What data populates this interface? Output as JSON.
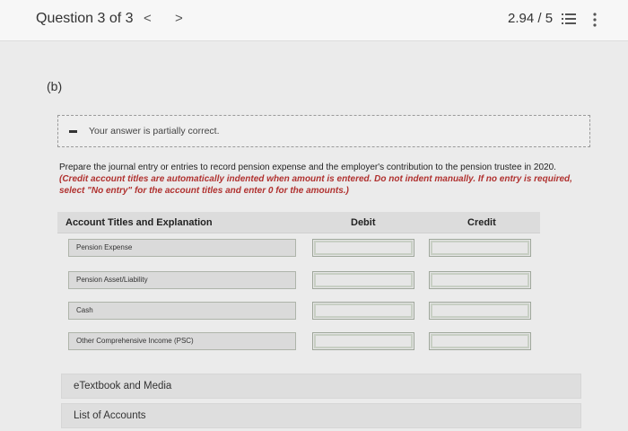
{
  "header": {
    "question": "Question 3 of 3",
    "prev_glyph": "<",
    "next_glyph": ">",
    "score": "2.94 / 5",
    "icons": [
      "list-icon",
      "more-vertical-icon"
    ]
  },
  "part": "(b)",
  "feedback": {
    "icon": "dash-icon",
    "text": "Your answer is partially correct."
  },
  "instructions": {
    "prompt": "Prepare the journal entry or entries to record pension expense and the employer's contribution to the pension trustee in 2020.",
    "note": "(Credit account titles are automatically indented when amount is entered. Do not indent manually. If no entry is required, select \"No entry\" for the account titles and enter 0 for the amounts.)"
  },
  "table": {
    "headers": {
      "account": "Account Titles and Explanation",
      "debit": "Debit",
      "credit": "Credit"
    },
    "rows": [
      {
        "account": "Pension Expense",
        "debit": "",
        "credit": ""
      },
      {
        "account": "Pension Asset/Liability",
        "debit": "",
        "credit": ""
      },
      {
        "account": "Cash",
        "debit": "",
        "credit": ""
      },
      {
        "account": "Other Comprehensive Income (PSC)",
        "debit": "",
        "credit": ""
      }
    ]
  },
  "links": {
    "etextbook": "eTextbook and Media",
    "accounts": "List of Accounts"
  }
}
